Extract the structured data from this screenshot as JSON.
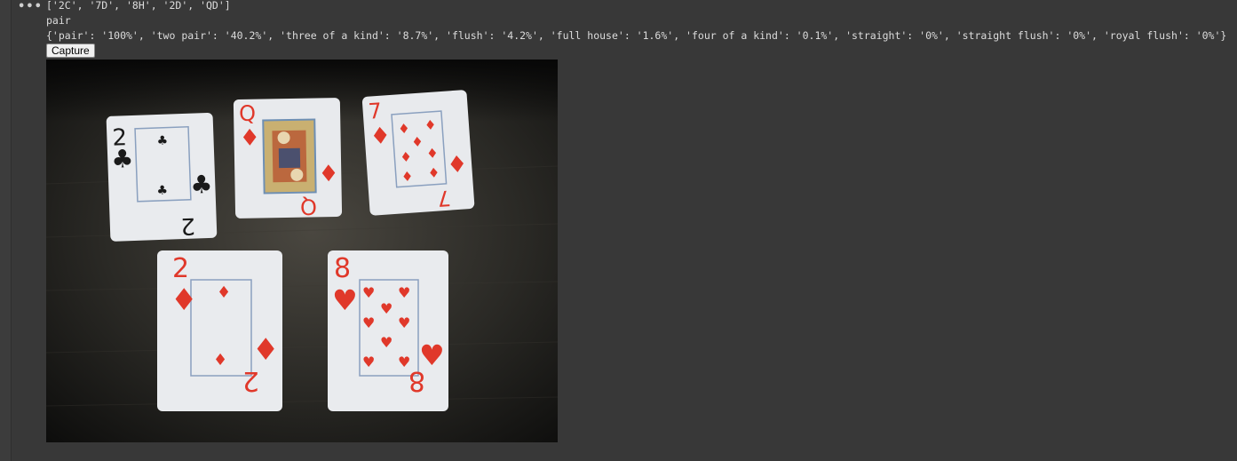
{
  "cell": {
    "more_icon": "•••"
  },
  "output": {
    "cards_line": "['2C', '7D', '8H', '2D', 'QD']",
    "hand_line": "pair",
    "probabilities_line": "{'pair': '100%', 'two pair': '40.2%', 'three of a kind': '8.7%', 'flush': '4.2%', 'full house': '1.6%', 'four of a kind': '0.1%', 'straight': '0%', 'straight flush': '0%', 'royal flush': '0%'}",
    "capture_label": "Capture"
  },
  "photo": {
    "cards": [
      {
        "rank": "2",
        "suit": "♣",
        "color": "#1a1a1a"
      },
      {
        "rank": "Q",
        "suit": "♦",
        "color": "#e0382a"
      },
      {
        "rank": "7",
        "suit": "♦",
        "color": "#e0382a"
      },
      {
        "rank": "2",
        "suit": "♦",
        "color": "#e0382a"
      },
      {
        "rank": "8",
        "suit": "♥",
        "color": "#e0382a"
      }
    ]
  },
  "colors": {
    "background": "#383838",
    "text": "#dcdcdc",
    "card_red": "#e0382a",
    "card_black": "#1a1a1a",
    "court_frame": "#6e8fb3"
  }
}
